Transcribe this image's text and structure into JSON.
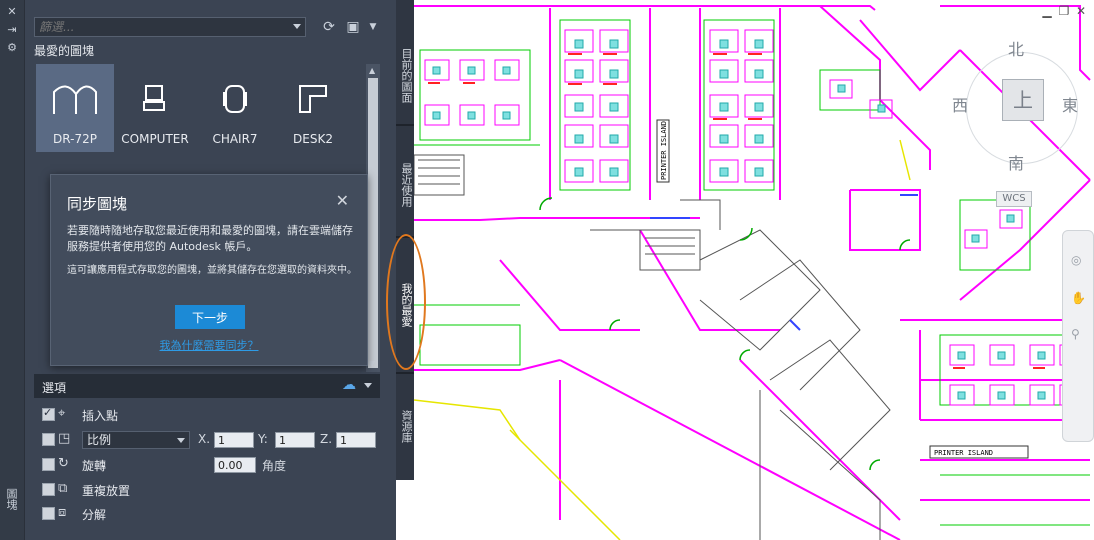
{
  "palette": {
    "filter": {
      "placeholder": "篩選..."
    },
    "favorites_heading": "最愛的圖塊",
    "blocks": [
      {
        "label": "DR-72P",
        "selected": true
      },
      {
        "label": "COMPUTER",
        "selected": false
      },
      {
        "label": "CHAIR7",
        "selected": false
      },
      {
        "label": "DESK2",
        "selected": false
      }
    ],
    "side_label": "圖塊"
  },
  "sync_dialog": {
    "title": "同步圖塊",
    "text1": "若要隨時隨地存取您最近使用和最愛的圖塊，請在雲端儲存服務提供者使用您的 Autodesk 帳戶。",
    "text2": "這可讓應用程式存取您的圖塊，並將其儲存在您選取的資料夾中。",
    "next_button": "下一步",
    "why_link": "我為什麼需要同步？"
  },
  "options": {
    "title": "選項",
    "insertion_point": {
      "label": "插入點",
      "checked": true
    },
    "scale": {
      "value": "比例",
      "checked": false,
      "x_label": "X.",
      "x": "1",
      "y_label": "Y:",
      "y": "1",
      "z_label": "Z.",
      "z": "1"
    },
    "rotation": {
      "label": "旋轉",
      "checked": false,
      "angle": "0.00",
      "angle_label": "角度"
    },
    "repeat": {
      "label": "重複放置",
      "checked": false
    },
    "explode": {
      "label": "分解",
      "checked": false
    }
  },
  "tabs": [
    "目前的圖面",
    "最近使用",
    "我的最愛",
    "資源庫"
  ],
  "viewcube": {
    "north": "北",
    "south": "南",
    "east": "東",
    "west": "西",
    "top": "上",
    "wcs": "WCS"
  },
  "drawing": {
    "labels": [
      "PRINTER ISLAND",
      "PRINTER ISLAND"
    ]
  },
  "colors": {
    "panel": "#3b4453",
    "accent": "#1c8ad6",
    "highlight": "#e0781e",
    "cad_magenta": "#ff00ff",
    "cad_green": "#00cc00",
    "cad_yellow": "#e6e600"
  }
}
